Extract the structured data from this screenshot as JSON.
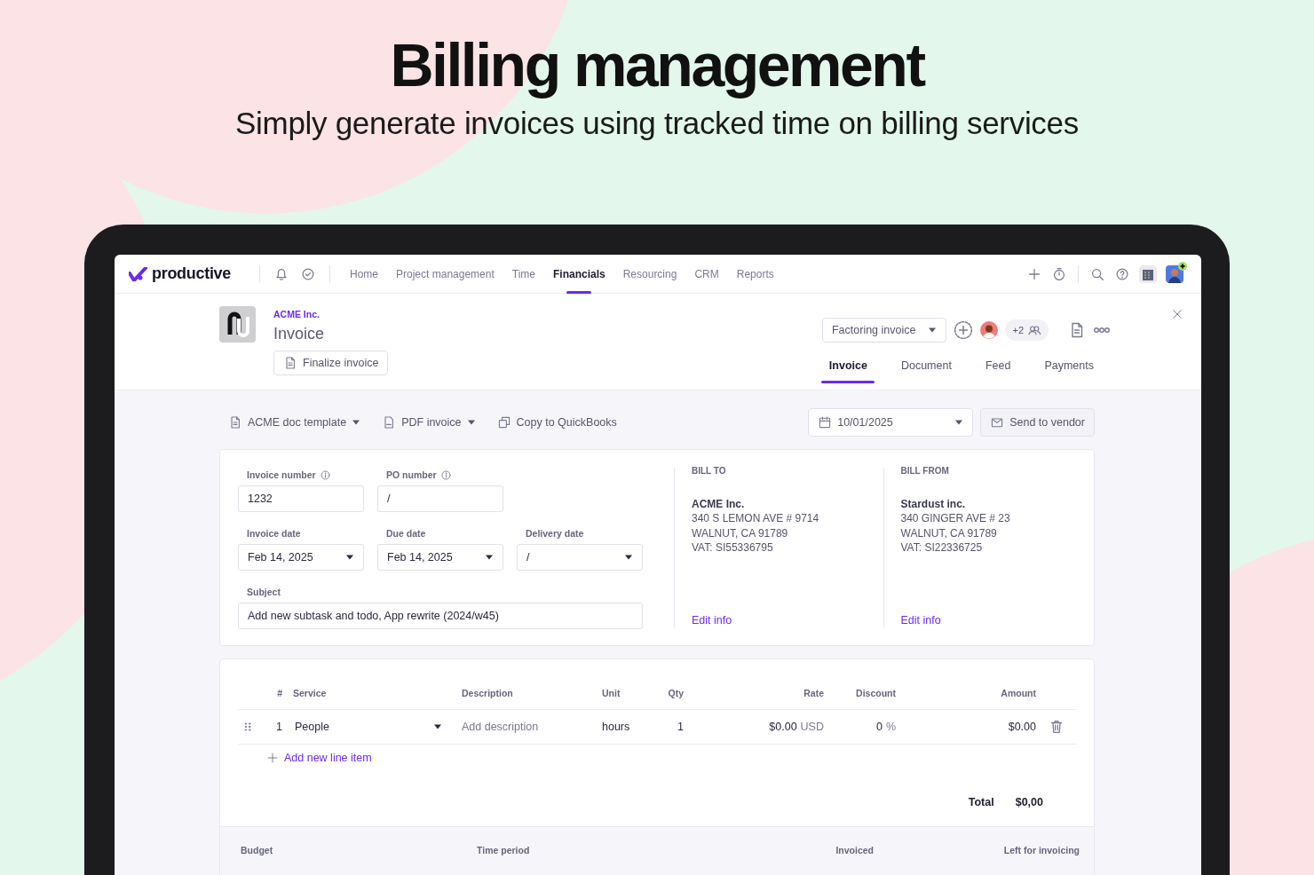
{
  "hero": {
    "title": "Billing management",
    "subtitle": "Simply generate invoices using tracked time on billing services"
  },
  "nav": {
    "logo": "productive",
    "items": [
      {
        "label": "Home",
        "selected": false
      },
      {
        "label": "Project management",
        "selected": false
      },
      {
        "label": "Time",
        "selected": false
      },
      {
        "label": "Financials",
        "selected": true
      },
      {
        "label": "Resourcing",
        "selected": false
      },
      {
        "label": "CRM",
        "selected": false
      },
      {
        "label": "Reports",
        "selected": false
      }
    ]
  },
  "header": {
    "client": "ACME Inc.",
    "title": "Invoice",
    "finalize_button": "Finalize invoice",
    "type_dropdown": "Factoring invoice",
    "extra_people": "+2",
    "tabs": [
      {
        "label": "Invoice",
        "selected": true
      },
      {
        "label": "Document",
        "selected": false
      },
      {
        "label": "Feed",
        "selected": false
      },
      {
        "label": "Payments",
        "selected": false
      }
    ]
  },
  "toolbar": {
    "template": "ACME doc template",
    "pdf": "PDF invoice",
    "copy": "Copy to QuickBooks",
    "date": "10/01/2025",
    "send": "Send to vendor"
  },
  "details": {
    "rows": [
      [
        {
          "label": "Invoice number",
          "value": "1232",
          "info": true,
          "kind": "text"
        },
        {
          "label": "PO number",
          "value": "/",
          "info": true,
          "kind": "text"
        }
      ],
      [
        {
          "label": "Invoice date",
          "value": "Feb 14, 2025",
          "info": false,
          "kind": "select"
        },
        {
          "label": "Due date",
          "value": "Feb 14, 2025",
          "info": false,
          "kind": "select"
        },
        {
          "label": "Delivery date",
          "value": "/",
          "info": false,
          "kind": "select"
        }
      ],
      [
        {
          "label": "Subject",
          "value": "Add new subtask and todo, App rewrite (2024/w45)",
          "info": false,
          "kind": "wide"
        }
      ]
    ],
    "bill": [
      {
        "heading": "BILL TO",
        "name": "ACME Inc.",
        "lines": [
          "340 S LEMON AVE # 9714",
          "WALNUT, CA 91789",
          "VAT: SI55336795"
        ],
        "link": "Edit info"
      },
      {
        "heading": "BILL FROM",
        "name": "Stardust inc.",
        "lines": [
          "340 GINGER AVE # 23",
          "WALNUT, CA 91789",
          "VAT: SI22336725"
        ],
        "link": "Edit info"
      }
    ]
  },
  "line_items": {
    "columns": [
      "#",
      "Service",
      "Description",
      "Unit",
      "Qty",
      "Rate",
      "Discount",
      "Amount"
    ],
    "rows": [
      {
        "number": "1",
        "service": "People",
        "description_placeholder": "Add description",
        "unit": "hours",
        "qty": "1",
        "rate": "$0.00",
        "currency": "USD",
        "discount": "0",
        "discount_unit": "%",
        "amount": "$0.00"
      }
    ],
    "add_line": "Add new line item",
    "total_label": "Total",
    "total": "$0,00"
  },
  "budget": {
    "columns": [
      "Budget",
      "Time period",
      "Invoiced",
      "Left for invoicing"
    ]
  }
}
